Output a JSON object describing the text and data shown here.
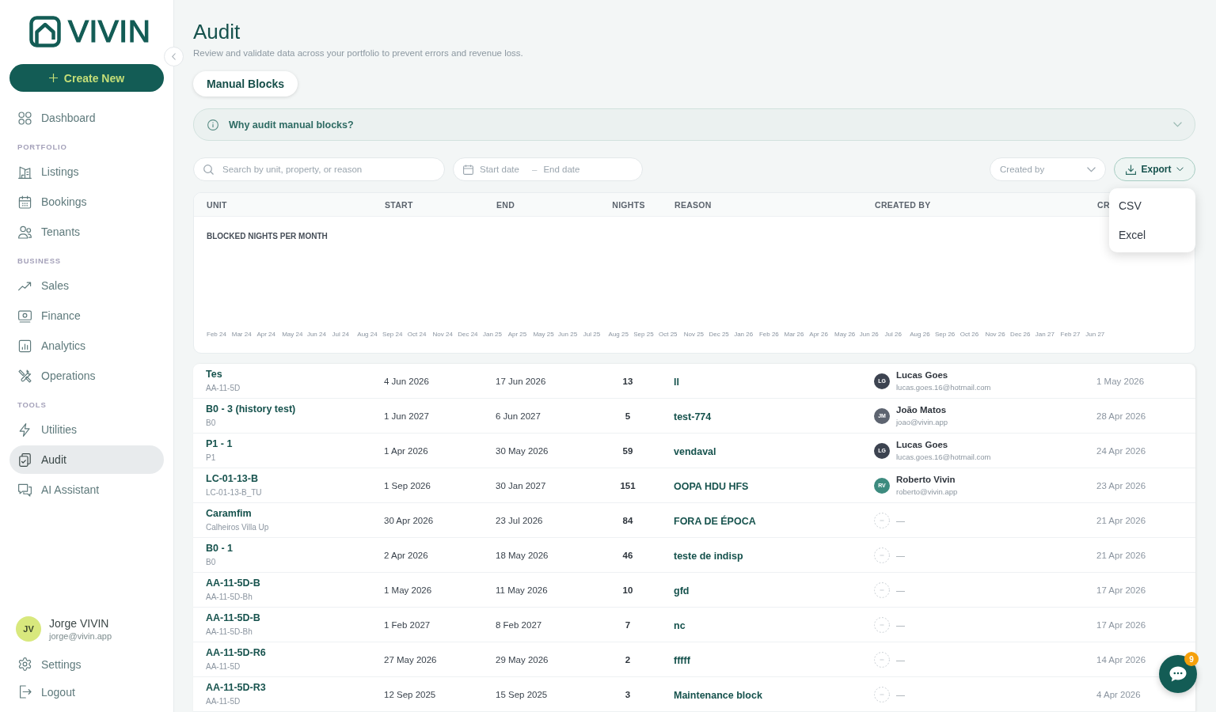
{
  "sidebar": {
    "logo": "VIVIN",
    "create_button": "Create New",
    "sections": [
      {
        "items": [
          {
            "label": "Dashboard",
            "selected": false
          }
        ]
      },
      {
        "heading": "PORTFOLIO",
        "items": [
          {
            "label": "Listings",
            "selected": false
          },
          {
            "label": "Bookings",
            "selected": false
          },
          {
            "label": "Tenants",
            "selected": false
          }
        ]
      },
      {
        "heading": "BUSINESS",
        "items": [
          {
            "label": "Sales",
            "selected": false
          },
          {
            "label": "Finance",
            "selected": false
          },
          {
            "label": "Analytics",
            "selected": false
          },
          {
            "label": "Operations",
            "selected": false
          }
        ]
      },
      {
        "heading": "TOOLS",
        "items": [
          {
            "label": "Utilities",
            "selected": false
          },
          {
            "label": "Audit",
            "selected": true
          },
          {
            "label": "AI Assistant",
            "selected": false
          }
        ]
      }
    ],
    "user": {
      "initials": "JV",
      "name": "Jorge VIVIN",
      "email": "jorge@vivin.app"
    },
    "footer_links": [
      {
        "label": "Settings"
      },
      {
        "label": "Logout"
      }
    ]
  },
  "page": {
    "title": "Audit",
    "subtitle": "Review and validate data across your portfolio to prevent errors and revenue loss."
  },
  "tabs": [
    {
      "label": "Manual Blocks",
      "selected": true
    }
  ],
  "info": {
    "title": "Why audit manual blocks?",
    "expanded": false
  },
  "filters": {
    "search": {
      "placeholder": "Search by unit, property, or reason"
    },
    "date_range": {
      "start_placeholder": "Start date",
      "separator": "–",
      "end_placeholder": "End date"
    },
    "created_by": {
      "placeholder": "Created by"
    },
    "export": {
      "label": "Export",
      "expanded": true,
      "menu_items": [
        "CSV",
        "Excel"
      ]
    }
  },
  "table": {
    "columns": [
      "UNIT",
      "START",
      "END",
      "NIGHTS",
      "REASON",
      "CREATED BY",
      "CR"
    ],
    "chart": {
      "title": "BLOCKED NIGHTS PER MONTH",
      "x_labels": [
        "Feb 24",
        "Mar 24",
        "Apr 24",
        "May 24",
        "Jun 24",
        "Jul 24",
        "Aug 24",
        "Sep 24",
        "Oct 24",
        "Nov 24",
        "Dec 24",
        "Jan 25",
        "Apr 25",
        "May 25",
        "Jun 25",
        "Jul 25",
        "Aug 25",
        "Sep 25",
        "Oct 25",
        "Nov 25",
        "Dec 25",
        "Jan 26",
        "Feb 26",
        "Mar 26",
        "Apr 26",
        "May 26",
        "Jun 26",
        "Jul 26",
        "Aug 26",
        "Sep 26",
        "Oct 26",
        "Nov 26",
        "Dec 26",
        "Jan 27",
        "Feb 27",
        "Jun 27"
      ]
    },
    "rows": [
      {
        "unit": "Tes",
        "property": "AA-11-5D",
        "start": "4 Jun 2026",
        "end": "17 Jun 2026",
        "nights": "13",
        "reason": "ll",
        "created_by": {
          "kind": "user",
          "initials": "LG",
          "name": "Lucas Goes",
          "email": "lucas.goes.16@hotmail.com",
          "color": "#3c4350"
        },
        "created_at": "1 May 2026"
      },
      {
        "unit": "B0 - 3 (history test)",
        "property": "B0",
        "start": "1 Jun 2027",
        "end": "6 Jun 2027",
        "nights": "5",
        "reason": "test-774",
        "created_by": {
          "kind": "user",
          "initials": "JM",
          "name": "João Matos",
          "email": "joao@vivin.app",
          "color": "#5d6470"
        },
        "created_at": "28 Apr 2026"
      },
      {
        "unit": "P1 - 1",
        "property": "P1",
        "start": "1 Apr 2026",
        "end": "30 May 2026",
        "nights": "59",
        "reason": "vendaval",
        "created_by": {
          "kind": "user",
          "initials": "LG",
          "name": "Lucas Goes",
          "email": "lucas.goes.16@hotmail.com",
          "color": "#3c4350"
        },
        "created_at": "24 Apr 2026"
      },
      {
        "unit": "LC-01-13-B",
        "property": "LC-01-13-B_TU",
        "start": "1 Sep 2026",
        "end": "30 Jan 2027",
        "nights": "151",
        "reason": "OOPA HDU HFS",
        "created_by": {
          "kind": "user",
          "initials": "RV",
          "name": "Roberto Vivin",
          "email": "roberto@vivin.app",
          "color": "#3d8b7f"
        },
        "created_at": "23 Apr 2026"
      },
      {
        "unit": "Caramfim",
        "property": "Calheiros Villa Up",
        "start": "30 Apr 2026",
        "end": "23 Jul 2026",
        "nights": "84",
        "reason": "FORA DE ÉPOCA",
        "created_by": {
          "kind": "none",
          "name": "—"
        },
        "created_at": "21 Apr 2026"
      },
      {
        "unit": "B0 - 1",
        "property": "B0",
        "start": "2 Apr 2026",
        "end": "18 May 2026",
        "nights": "46",
        "reason": "teste de indisp",
        "created_by": {
          "kind": "none",
          "name": "—"
        },
        "created_at": "21 Apr 2026"
      },
      {
        "unit": "AA-11-5D-B",
        "property": "AA-11-5D-Bh",
        "start": "1 May 2026",
        "end": "11 May 2026",
        "nights": "10",
        "reason": "gfd",
        "created_by": {
          "kind": "none",
          "name": "—"
        },
        "created_at": "17 Apr 2026"
      },
      {
        "unit": "AA-11-5D-B",
        "property": "AA-11-5D-Bh",
        "start": "1 Feb 2027",
        "end": "8 Feb 2027",
        "nights": "7",
        "reason": "nc",
        "created_by": {
          "kind": "none",
          "name": "—"
        },
        "created_at": "17 Apr 2026"
      },
      {
        "unit": "AA-11-5D-R6",
        "property": "AA-11-5D",
        "start": "27 May 2026",
        "end": "29 May 2026",
        "nights": "2",
        "reason": "fffff",
        "created_by": {
          "kind": "none",
          "name": "—"
        },
        "created_at": "14 Apr 2026"
      },
      {
        "unit": "AA-11-5D-R3",
        "property": "AA-11-5D",
        "start": "12 Sep 2025",
        "end": "15 Sep 2025",
        "nights": "3",
        "reason": "Maintenance block",
        "created_by": {
          "kind": "none",
          "name": "—"
        },
        "created_at": "4 Apr 2026"
      }
    ]
  },
  "chat": {
    "badge": "9"
  }
}
